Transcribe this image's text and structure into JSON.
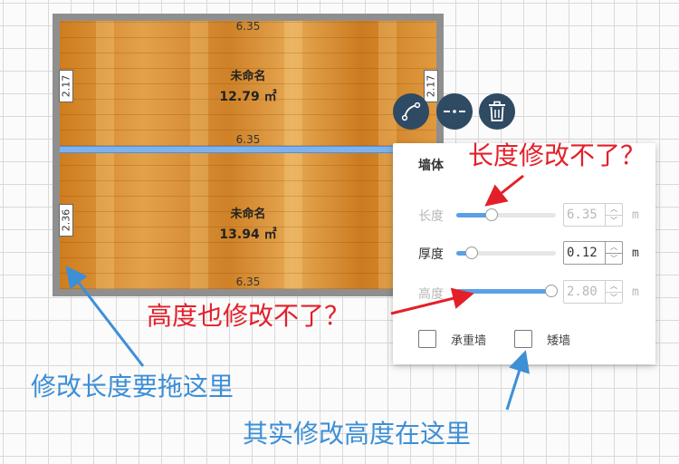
{
  "plan": {
    "top_room": {
      "name": "未命名",
      "area": "12.79 ㎡"
    },
    "bottom_room": {
      "name": "未命名",
      "area": "13.94 ㎡"
    },
    "dimensions": {
      "top": "6.35",
      "middle": "6.35",
      "bottom": "6.35",
      "left_top": "2.17",
      "right_top": "2.17",
      "left_bottom": "2.36"
    },
    "colors": {
      "wall": "#8f8f8f",
      "selected_wall": "#7fb2ec",
      "floor": "#d48b2a"
    }
  },
  "toolbar": {
    "tools": [
      {
        "icon": "curve-wall-icon"
      },
      {
        "icon": "split-wall-icon"
      },
      {
        "icon": "trash-icon"
      }
    ],
    "color": "#2f4a63"
  },
  "wall_panel": {
    "title": "墙体",
    "length": {
      "label": "长度",
      "value": "6.35",
      "unit": "m",
      "fill": 0.35,
      "enabled": false
    },
    "thickness": {
      "label": "厚度",
      "value": "0.12",
      "unit": "m",
      "fill": 0.15,
      "enabled": true
    },
    "height": {
      "label": "高度",
      "value": "2.80",
      "unit": "m",
      "fill": 0.95,
      "enabled": false
    },
    "load_bearing_label": "承重墙",
    "low_wall_label": "矮墙"
  },
  "annotations": {
    "length_note": "长度修改不了？",
    "height_note": "高度也修改不了？",
    "drag_note": "修改长度要拖这里",
    "height_here_note": "其实修改高度在这里",
    "red": "#e3202a",
    "blue": "#3d8fd6"
  }
}
